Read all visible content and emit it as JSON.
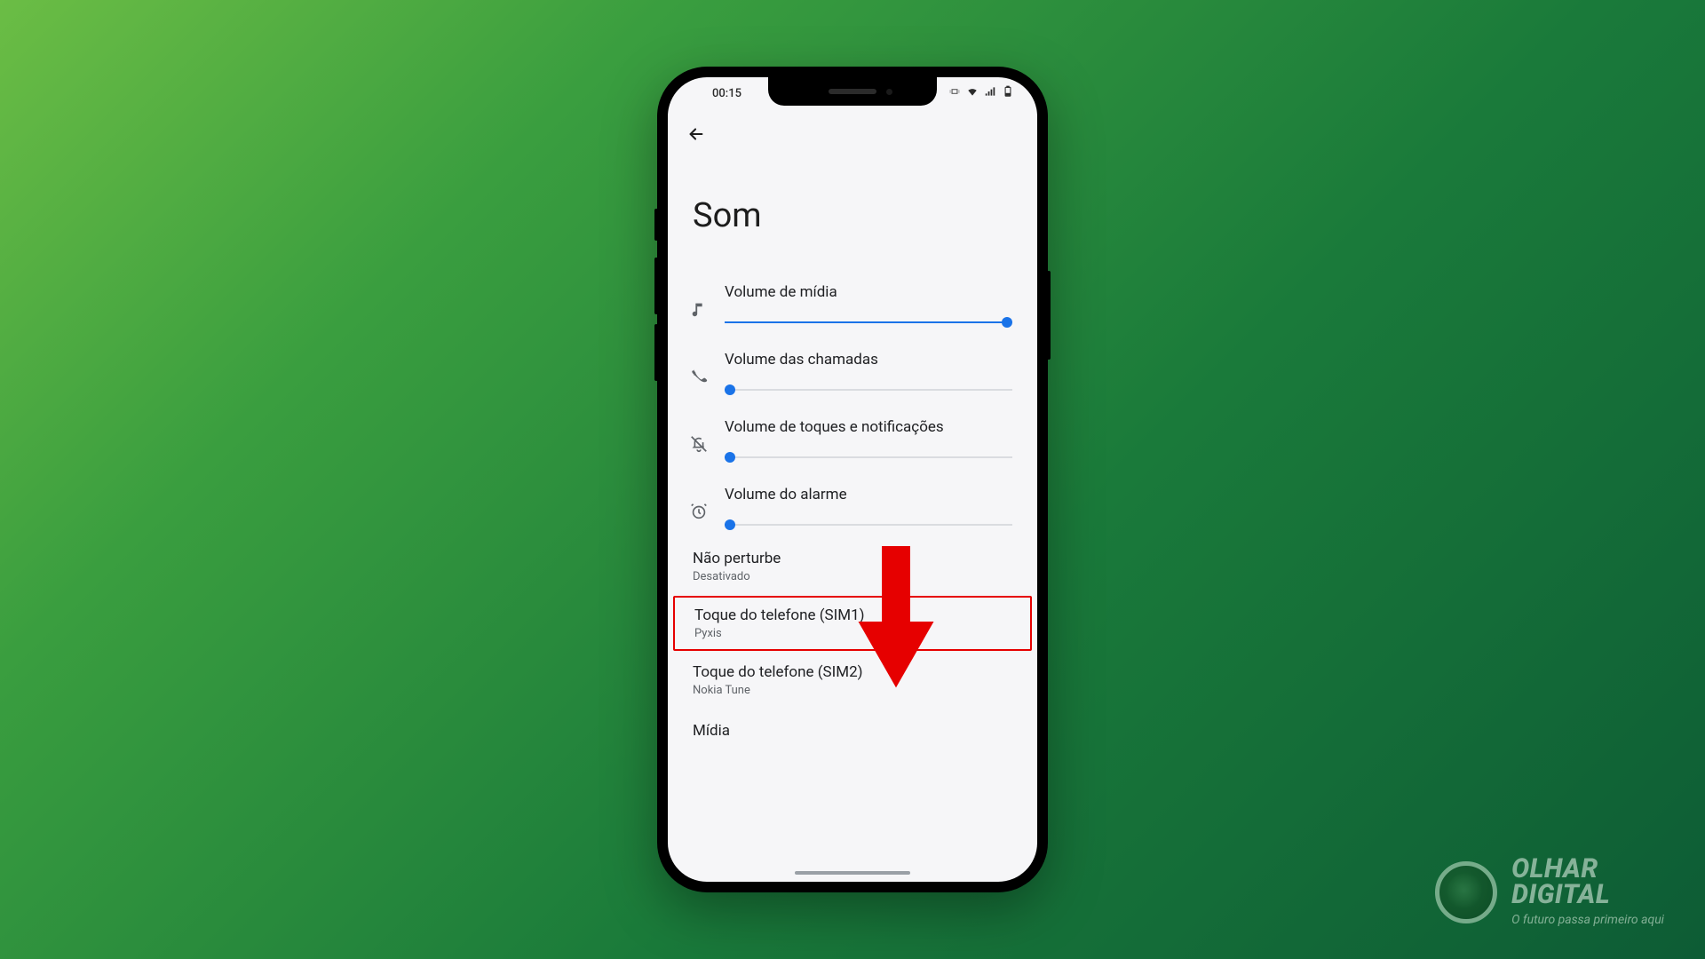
{
  "status": {
    "time": "00:15"
  },
  "page": {
    "title": "Som"
  },
  "sliders": {
    "media": {
      "label": "Volume de mídia",
      "value": 98
    },
    "calls": {
      "label": "Volume das chamadas",
      "value": 2
    },
    "ring": {
      "label": "Volume de toques e notificações",
      "value": 2
    },
    "alarm": {
      "label": "Volume do alarme",
      "value": 2
    }
  },
  "rows": {
    "dnd": {
      "title": "Não perturbe",
      "sub": "Desativado"
    },
    "sim1": {
      "title": "Toque do telefone (SIM1)",
      "sub": "Pyxis"
    },
    "sim2": {
      "title": "Toque do telefone (SIM2)",
      "sub": "Nokia Tune"
    },
    "media": {
      "title": "Mídia"
    }
  },
  "brand": {
    "name_line1": "OLHAR",
    "name_line2": "DIGITAL",
    "tagline": "O futuro passa primeiro aqui"
  }
}
